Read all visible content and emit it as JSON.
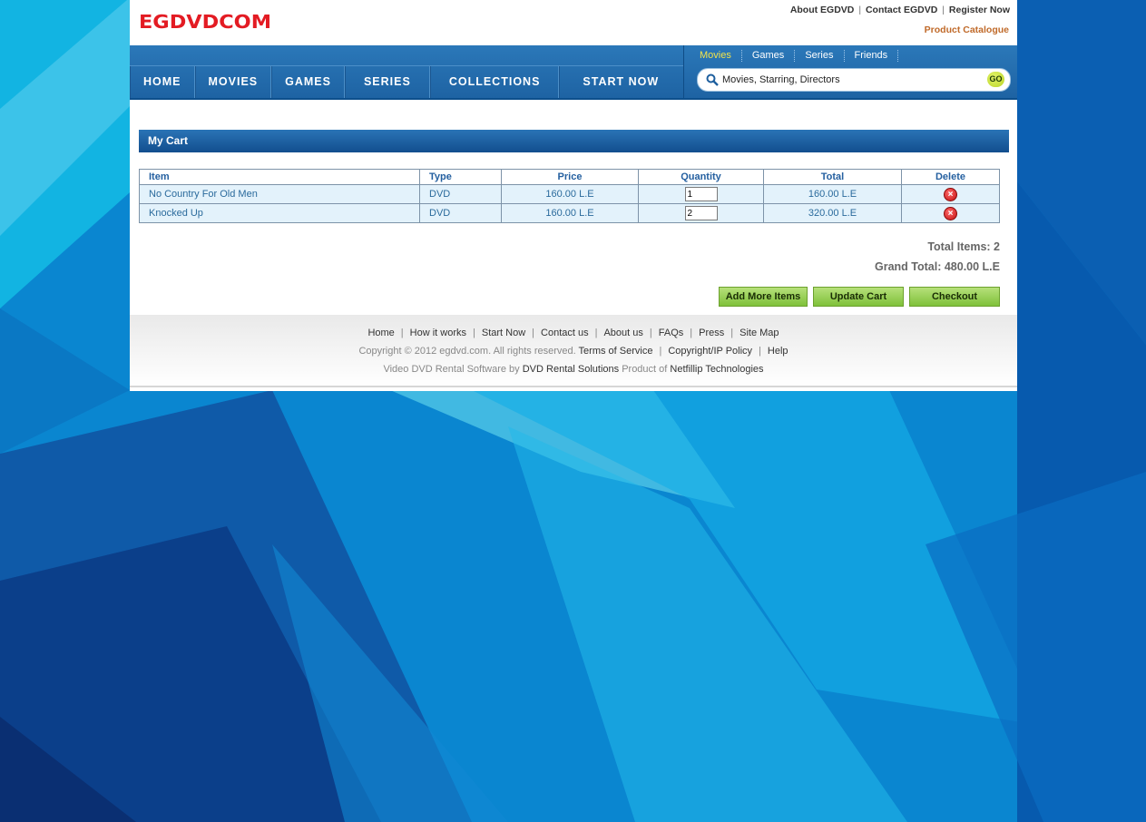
{
  "logo_text": "EGDVDCOM",
  "top_links": {
    "about": "About EGDVD",
    "contact": "Contact EGDVD",
    "register": "Register Now",
    "separator": "|",
    "catalogue": "Product Catalogue"
  },
  "main_nav": [
    "HOME",
    "MOVIES",
    "GAMES",
    "SERIES",
    "COLLECTIONS",
    "START NOW"
  ],
  "sub_tabs": [
    "Movies",
    "Games",
    "Series",
    "Friends"
  ],
  "search": {
    "placeholder": "Movies, Starring, Directors",
    "go_label": "GO"
  },
  "cart": {
    "title": "My Cart",
    "columns": [
      "Item",
      "Type",
      "Price",
      "Quantity",
      "Total",
      "Delete"
    ],
    "rows": [
      {
        "item": "No Country For Old Men",
        "type": "DVD",
        "price": "160.00 L.E",
        "quantity": "1",
        "total": "160.00 L.E"
      },
      {
        "item": "Knocked Up",
        "type": "DVD",
        "price": "160.00 L.E",
        "quantity": "2",
        "total": "320.00 L.E"
      }
    ],
    "total_items": "Total Items: 2",
    "grand_total": "Grand Total: 480.00 L.E"
  },
  "buttons": {
    "add_more": "Add More Items",
    "update": "Update Cart",
    "checkout": "Checkout"
  },
  "footer": {
    "links": [
      "Home",
      "How it works",
      "Start Now",
      "Contact us",
      "About us",
      "FAQs",
      "Press",
      "Site Map"
    ],
    "separator": "|",
    "copyright": "Copyright © 2012 egdvd.com. All rights reserved.",
    "terms": "Terms of Service",
    "copyright_policy": "Copyright/IP Policy",
    "help": "Help",
    "software_prefix": "Video DVD Rental Software by",
    "software_link": "DVD Rental Solutions",
    "product_of": "Product of",
    "company": "Netfillip Technologies"
  },
  "colors": {
    "accent_blue": "#1e63a3",
    "brand_red": "#e31b23",
    "button_green": "#7fc13a"
  }
}
